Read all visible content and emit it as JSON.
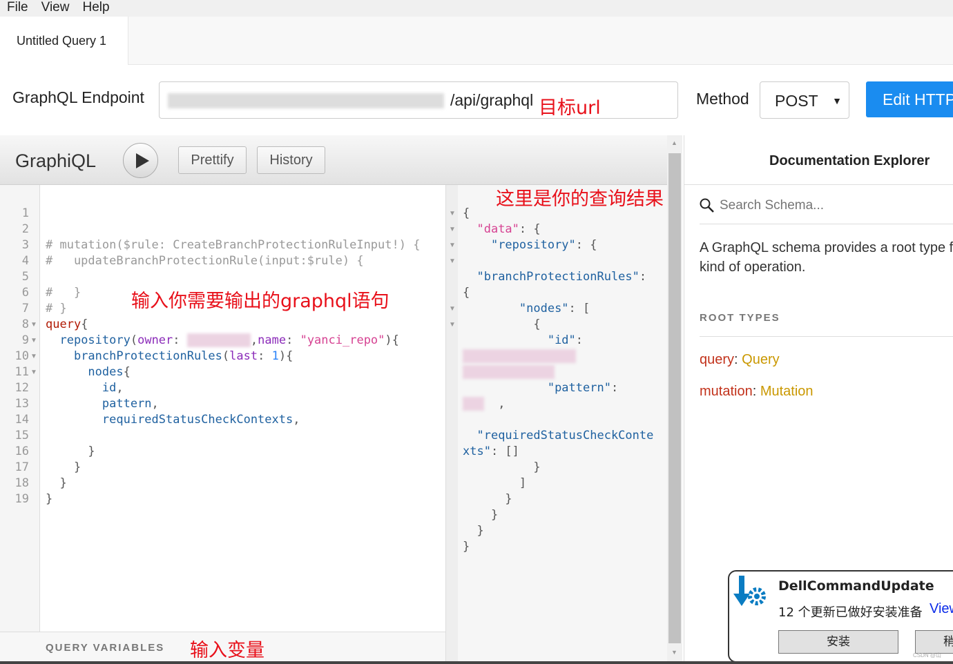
{
  "menu": [
    "File",
    "View",
    "Help"
  ],
  "tab": "Untitled Query 1",
  "endpoint": {
    "label": "GraphQL Endpoint",
    "value_visible": "/api/graphql",
    "annotation": "目标url"
  },
  "method": {
    "label": "Method",
    "value": "POST"
  },
  "edit_button": "Edit HTTP",
  "toolbar": {
    "logo": "GraphiQL",
    "prettify": "Prettify",
    "history": "History"
  },
  "editor": {
    "annotation": "输入你需要输出的graphql语句",
    "line_count": 19,
    "lines": [
      [],
      [],
      [
        [
          "cm",
          "# mutation($rule: CreateBranchProtectionRuleInput!) {"
        ]
      ],
      [
        [
          "cm",
          "#   updateBranchProtectionRule(input:$rule) {"
        ]
      ],
      [],
      [
        [
          "cm",
          "#   }"
        ]
      ],
      [
        [
          "cm",
          "# }"
        ]
      ],
      [
        [
          "kw",
          "query"
        ],
        [
          "pl",
          "{"
        ]
      ],
      [
        [
          "pl",
          "  "
        ],
        [
          "fd",
          "repository"
        ],
        [
          "pl",
          "("
        ],
        [
          "at",
          "owner"
        ],
        [
          "pl",
          ": "
        ],
        [
          "blur",
          "         "
        ],
        [
          "pl",
          ","
        ],
        [
          "at",
          "name"
        ],
        [
          "pl",
          ": "
        ],
        [
          "st",
          "\"yanci_repo\""
        ],
        [
          "pl",
          "){"
        ]
      ],
      [
        [
          "pl",
          "    "
        ],
        [
          "fd",
          "branchProtectionRules"
        ],
        [
          "pl",
          "("
        ],
        [
          "at",
          "last"
        ],
        [
          "pl",
          ": "
        ],
        [
          "nm",
          "1"
        ],
        [
          "pl",
          "){"
        ]
      ],
      [
        [
          "pl",
          "      "
        ],
        [
          "fd",
          "nodes"
        ],
        [
          "pl",
          "{"
        ]
      ],
      [
        [
          "pl",
          "        "
        ],
        [
          "fd",
          "id"
        ],
        [
          "pl",
          ","
        ]
      ],
      [
        [
          "pl",
          "        "
        ],
        [
          "fd",
          "pattern"
        ],
        [
          "pl",
          ","
        ]
      ],
      [
        [
          "pl",
          "        "
        ],
        [
          "fd",
          "requiredStatusCheckContexts"
        ],
        [
          "pl",
          ","
        ]
      ],
      [],
      [
        [
          "pl",
          "      }"
        ]
      ],
      [
        [
          "pl",
          "    }"
        ]
      ],
      [
        [
          "pl",
          "  }"
        ]
      ],
      [
        [
          "pl",
          "}"
        ]
      ]
    ],
    "fold_lines": [
      8,
      9,
      10,
      11
    ]
  },
  "results": {
    "annotation": "这里是你的查询结果",
    "lines": [
      [
        [
          "pl",
          "{"
        ]
      ],
      [
        [
          "pl",
          "  "
        ],
        [
          "st",
          "\"data\""
        ],
        [
          "pl",
          ": {"
        ]
      ],
      [
        [
          "pl",
          "    "
        ],
        [
          "pk",
          "\"repository\""
        ],
        [
          "pl",
          ": {"
        ]
      ],
      [],
      [
        [
          "pl",
          "  "
        ],
        [
          "pk",
          "\"branchProtectionRules\""
        ],
        [
          "pl",
          ":"
        ]
      ],
      [
        [
          "pl",
          "{"
        ]
      ],
      [
        [
          "pl",
          "        "
        ],
        [
          "pk",
          "\"nodes\""
        ],
        [
          "pl",
          ": ["
        ]
      ],
      [
        [
          "pl",
          "          {"
        ]
      ],
      [
        [
          "pl",
          "            "
        ],
        [
          "pk",
          "\"id\""
        ],
        [
          "pl",
          ":"
        ]
      ],
      [
        [
          "blur",
          "                "
        ]
      ],
      [
        [
          "blur",
          "             "
        ]
      ],
      [
        [
          "pl",
          "            "
        ],
        [
          "pk",
          "\"pattern\""
        ],
        [
          "pl",
          ":"
        ]
      ],
      [
        [
          "blur",
          "   "
        ],
        [
          "pl",
          "  ,"
        ]
      ],
      [],
      [
        [
          "pl",
          "  "
        ],
        [
          "pk",
          "\"requiredStatusCheckConte"
        ]
      ],
      [
        [
          "pk",
          "xts\""
        ],
        [
          "pl",
          ": []"
        ]
      ],
      [
        [
          "pl",
          "          }"
        ]
      ],
      [
        [
          "pl",
          "        ]"
        ]
      ],
      [
        [
          "pl",
          "      }"
        ]
      ],
      [
        [
          "pl",
          "    }"
        ]
      ],
      [
        [
          "pl",
          "  }"
        ]
      ],
      [
        [
          "pl",
          "}"
        ]
      ]
    ]
  },
  "variables": {
    "label": "QUERY VARIABLES",
    "annotation": "输入变量"
  },
  "docs": {
    "title": "Documentation Explorer",
    "search_placeholder": "Search Schema...",
    "description": "A GraphQL schema provides a root type for each\nkind of operation.",
    "root_types_label": "ROOT TYPES",
    "root_types": [
      {
        "field": "query",
        "type": "Query"
      },
      {
        "field": "mutation",
        "type": "Mutation"
      }
    ]
  },
  "toast": {
    "title": "DellCommandUpdate",
    "message": "12 个更新已做好安装准备",
    "view": "View",
    "install": "安装",
    "later": "稍"
  },
  "watermark": "CSDN @山",
  "colors": {
    "accent": "#1a8cf0",
    "annotation": "#e8101a",
    "keyword": "#b11a04",
    "field": "#1f61a0",
    "string": "#d64292"
  }
}
